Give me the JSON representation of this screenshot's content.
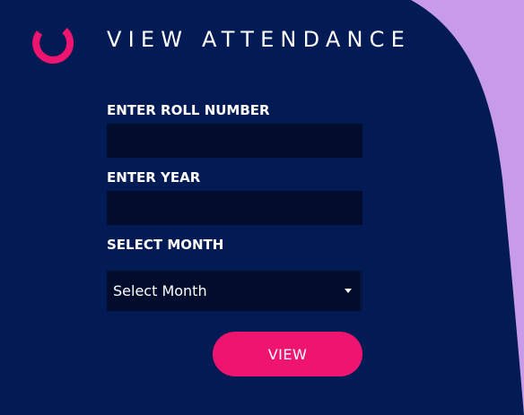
{
  "page": {
    "title": "VIEW ATTENDANCE"
  },
  "form": {
    "roll_label": "ENTER ROLL NUMBER",
    "roll_value": "",
    "year_label": "ENTER YEAR",
    "year_value": "",
    "month_label": "SELECT MONTH",
    "month_selected": "Select Month",
    "submit_label": "VIEW"
  },
  "icons": {
    "logo": "loading-ring-icon",
    "dropdown": "caret-down-icon"
  },
  "colors": {
    "background": "#031b55",
    "accent_blob": "#c79be8",
    "input_bg": "#020d2e",
    "accent_pink": "#ee1470",
    "text": "#ffffff"
  }
}
